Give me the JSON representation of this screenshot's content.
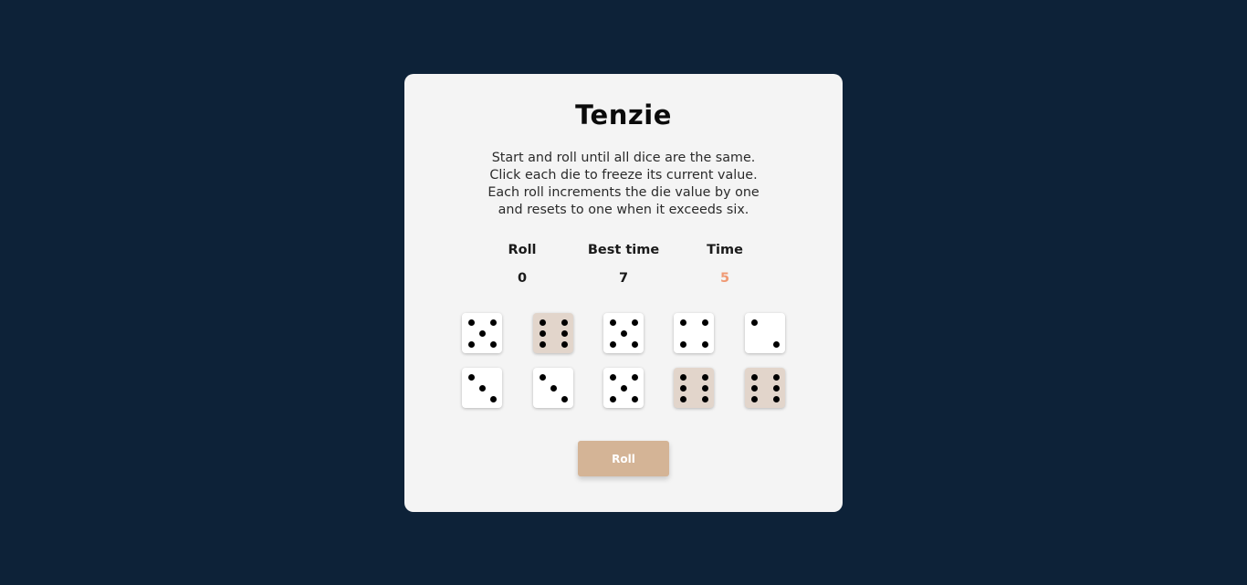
{
  "game": {
    "title": "Tenzie",
    "instructions": [
      "Start and roll until all dice are the same.",
      "Click each die to freeze its current value.",
      "Each roll increments the die value by one",
      "and resets to one when it exceeds six."
    ],
    "stats": {
      "roll": {
        "label": "Roll",
        "value": "0"
      },
      "best_time": {
        "label": "Best time",
        "value": "7"
      },
      "time": {
        "label": "Time",
        "value": "5"
      }
    },
    "dice": [
      {
        "value": 5,
        "held": false
      },
      {
        "value": 6,
        "held": true
      },
      {
        "value": 5,
        "held": false
      },
      {
        "value": 4,
        "held": false
      },
      {
        "value": 2,
        "held": false
      },
      {
        "value": 3,
        "held": false
      },
      {
        "value": 3,
        "held": false
      },
      {
        "value": 5,
        "held": false
      },
      {
        "value": 6,
        "held": true
      },
      {
        "value": 6,
        "held": true
      }
    ],
    "roll_button_label": "Roll"
  },
  "colors": {
    "background": "#0d2238",
    "card": "#f4f4f4",
    "die": "#ffffff",
    "die_held": "#e2d5cb",
    "button": "#d4b496",
    "time_accent": "#f09a74"
  }
}
